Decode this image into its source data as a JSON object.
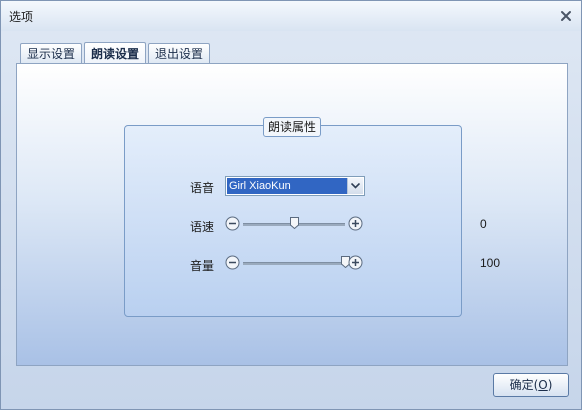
{
  "window": {
    "title": "选项"
  },
  "tabs": [
    {
      "label": "显示设置",
      "active": false
    },
    {
      "label": "朗读设置",
      "active": true
    },
    {
      "label": "退出设置",
      "active": false
    }
  ],
  "group": {
    "title": "朗读属性",
    "voice": {
      "label": "语音",
      "selected": "Girl XiaoKun"
    },
    "speed": {
      "label": "语速",
      "value": "0",
      "level": 0.5
    },
    "volume": {
      "label": "音量",
      "value": "100",
      "level": 1.0
    }
  },
  "footer": {
    "ok_label": "确定",
    "ok_mnemonic_prefix": "(",
    "ok_mnemonic": "O",
    "ok_mnemonic_suffix": ")"
  },
  "colors": {
    "selection": "#3166c3",
    "panel_bottom": "#a9c1e6",
    "border": "#8ea4c2"
  },
  "icons": {
    "close": "close-icon",
    "dropdown": "chevron-down-icon",
    "minus": "minus-circle-icon",
    "plus": "plus-circle-icon"
  }
}
